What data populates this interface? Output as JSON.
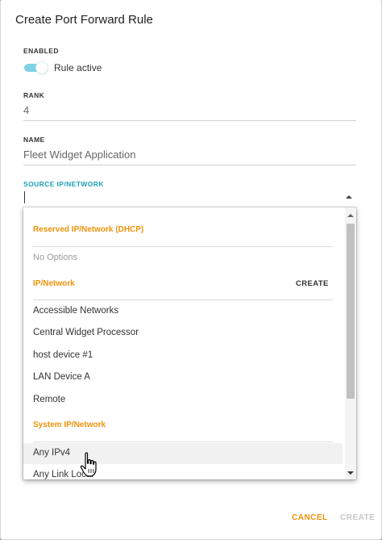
{
  "dialog": {
    "title": "Create Port Forward Rule"
  },
  "enabled": {
    "label": "ENABLED",
    "toggle_text": "Rule active",
    "toggle_on": true
  },
  "rank": {
    "label": "RANK",
    "value": "4"
  },
  "name": {
    "label": "NAME",
    "value": "Fleet Widget Application"
  },
  "source": {
    "label": "SOURCE IP/NETWORK",
    "value": ""
  },
  "dropdown": {
    "group_reserved": "Reserved IP/Network (DHCP)",
    "no_options": "No Options",
    "group_ip": "IP/Network",
    "create_label": "CREATE",
    "ip_items": [
      "Accessible Networks",
      "Central Widget Processor",
      "host device #1",
      "LAN Device A",
      "Remote"
    ],
    "group_system": "System IP/Network",
    "system_items": [
      "Any IPv4",
      "Any Link Local"
    ]
  },
  "actions": {
    "cancel": "CANCEL",
    "create": "CREATE"
  },
  "colors": {
    "accent_orange": "#f0920a",
    "accent_teal": "#1ba1b8",
    "toggle_track": "#7fd3e4"
  }
}
